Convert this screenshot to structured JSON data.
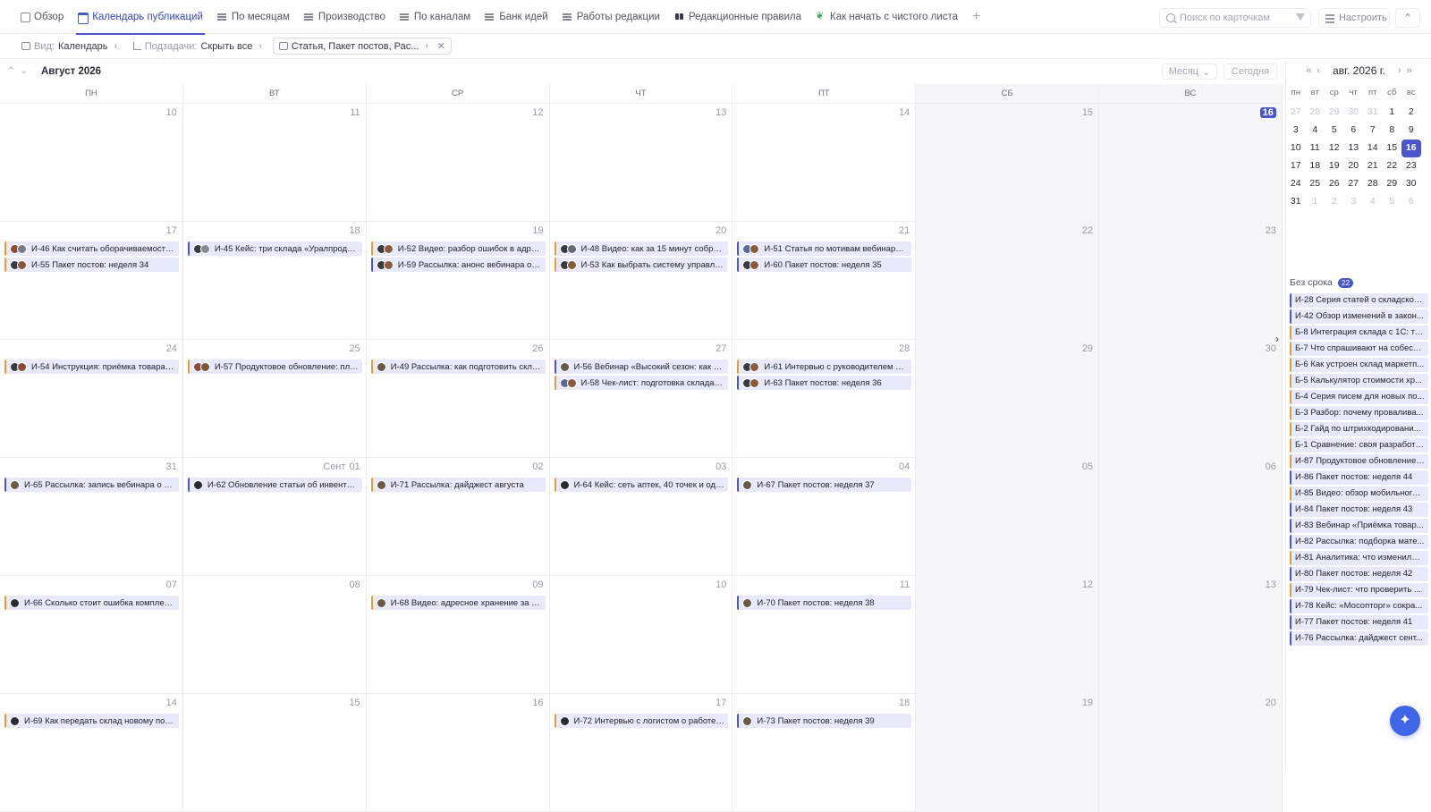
{
  "tabs": [
    {
      "label": "Обзор",
      "icon": "list-icon",
      "active": false
    },
    {
      "label": "Календарь публикаций",
      "icon": "calendar-icon",
      "active": true
    },
    {
      "label": "По месяцам",
      "icon": "grid-icon",
      "active": false
    },
    {
      "label": "Производство",
      "icon": "grid-icon",
      "active": false
    },
    {
      "label": "По каналам",
      "icon": "grid-icon",
      "active": false
    },
    {
      "label": "Банк идей",
      "icon": "grid-icon",
      "active": false
    },
    {
      "label": "Работы редакции",
      "icon": "grid-icon",
      "active": false
    },
    {
      "label": "Редакционные правила",
      "icon": "book-icon",
      "active": false
    },
    {
      "label": "Как начать с чистого листа",
      "icon": "leaf-icon",
      "active": false
    }
  ],
  "search": {
    "placeholder": "Поиск по карточкам"
  },
  "configure_label": "Настроить",
  "filters": {
    "view_label": "Вид:",
    "view_value": "Календарь",
    "subtasks_label": "Подзадачи:",
    "subtasks_value": "Скрыть все",
    "types_value": "Статья, Пакет постов, Рас..."
  },
  "calendar": {
    "month_title": "Август 2026",
    "view_mode": "Месяц",
    "today_label": "Сегодня",
    "weekdays": [
      "ПН",
      "ВТ",
      "СР",
      "ЧТ",
      "ПТ",
      "СБ",
      "ВС"
    ],
    "weeks": [
      [
        {
          "n": "10",
          "events": []
        },
        {
          "n": "11",
          "events": []
        },
        {
          "n": "12",
          "events": []
        },
        {
          "n": "13",
          "events": []
        },
        {
          "n": "14",
          "events": []
        },
        {
          "n": "15",
          "events": []
        },
        {
          "n": "16",
          "today": true,
          "events": []
        }
      ],
      [
        {
          "n": "17",
          "events": [
            {
              "text": "И-46 Как считать оборачиваемость с...",
              "av": [
                "#8b4a3a",
                "#7a7a86"
              ],
              "c": "orange"
            },
            {
              "text": "И-55 Пакет постов: неделя 34",
              "av": [
                "#3a3a44",
                "#8b5a3a"
              ],
              "c": "orange"
            }
          ]
        },
        {
          "n": "18",
          "events": [
            {
              "text": "И-45 Кейс: три склада «Уралпродукта...",
              "av": [
                "#3a3a44",
                "#8a8a96"
              ],
              "c": "blue"
            }
          ]
        },
        {
          "n": "19",
          "events": [
            {
              "text": "И-52 Видео: разбор ошибок в адресн...",
              "av": [
                "#3a3a44",
                "#8b5a3a"
              ],
              "c": "orange"
            },
            {
              "text": "И-59 Рассылка: анонс вебинара о выс...",
              "av": [
                "#3a3a44",
                "#8b5a3a"
              ],
              "c": "blue"
            }
          ]
        },
        {
          "n": "20",
          "events": [
            {
              "text": "И-48 Видео: как за 15 минут собрать ...",
              "av": [
                "#3a3a44",
                "#6a6a76"
              ],
              "c": "orange"
            },
            {
              "text": "И-53 Как выбрать систему управлени...",
              "av": [
                "#3a3a44",
                "#8b5a3a"
              ],
              "c": "orange"
            }
          ]
        },
        {
          "n": "21",
          "events": [
            {
              "text": "И-51 Статья по мотивам вебинара о п...",
              "av": [
                "#5a6a9a",
                "#8b5a3a"
              ],
              "c": "blue"
            },
            {
              "text": "И-60 Пакет постов: неделя 35",
              "av": [
                "#3a3a44",
                "#8b5a3a"
              ],
              "c": "blue"
            }
          ]
        },
        {
          "n": "22",
          "events": []
        },
        {
          "n": "23",
          "events": []
        }
      ],
      [
        {
          "n": "24",
          "events": [
            {
              "text": "И-54 Инструкция: приёмка товара по ...",
              "av": [
                "#3a3a44",
                "#8b4a3a"
              ],
              "c": "orange"
            }
          ]
        },
        {
          "n": "25",
          "events": [
            {
              "text": "И-57 Продуктовое обновление: плани...",
              "av": [
                "#8b4a3a",
                "#7a5a3a"
              ],
              "c": "orange"
            }
          ]
        },
        {
          "n": "26",
          "events": [
            {
              "text": "И-49 Рассылка: как подготовить склад...",
              "av": [
                "#6a5a4a"
              ],
              "c": "orange"
            }
          ]
        },
        {
          "n": "27",
          "events": [
            {
              "text": "И-56 Вебинар «Высокий сезон: как скл...",
              "av": [
                "#6a5a4a"
              ],
              "c": "blue"
            },
            {
              "text": "И-58 Чек-лист: подготовка склада к с...",
              "av": [
                "#5a6a9a",
                "#8b5a3a"
              ],
              "c": "orange"
            }
          ]
        },
        {
          "n": "28",
          "events": [
            {
              "text": "И-61 Интервью с руководителем скла...",
              "av": [
                "#3a3a44",
                "#8b5a3a"
              ],
              "c": "orange"
            },
            {
              "text": "И-63 Пакет постов: неделя 36",
              "av": [
                "#3a3a44",
                "#8b5a3a"
              ],
              "c": "blue"
            }
          ]
        },
        {
          "n": "29",
          "events": []
        },
        {
          "n": "30",
          "events": []
        }
      ],
      [
        {
          "n": "31",
          "events": [
            {
              "text": "И-65 Рассылка: запись вебинара о выс...",
              "av": [
                "#6a5a4a"
              ],
              "c": "blue"
            }
          ]
        },
        {
          "n": "01",
          "mlabel": "Сент",
          "events": [
            {
              "text": "И-62 Обновление статьи об инвентари...",
              "av": [
                "#2b2b33"
              ],
              "c": "blue"
            }
          ]
        },
        {
          "n": "02",
          "events": [
            {
              "text": "И-71 Рассылка: дайджест августа",
              "av": [
                "#6a5a4a"
              ],
              "c": "orange"
            }
          ]
        },
        {
          "n": "03",
          "events": [
            {
              "text": "И-64 Кейс: сеть аптек, 40 точек и один...",
              "av": [
                "#2b2b33"
              ],
              "c": "orange"
            }
          ]
        },
        {
          "n": "04",
          "events": [
            {
              "text": "И-67 Пакет постов: неделя 37",
              "av": [
                "#6a5a4a"
              ],
              "c": "blue"
            }
          ]
        },
        {
          "n": "05",
          "events": []
        },
        {
          "n": "06",
          "events": []
        }
      ],
      [
        {
          "n": "07",
          "events": [
            {
              "text": "И-66 Сколько стоит ошибка комплекта...",
              "av": [
                "#2b2b33"
              ],
              "c": "orange"
            }
          ]
        },
        {
          "n": "08",
          "events": []
        },
        {
          "n": "09",
          "events": [
            {
              "text": "И-68 Видео: адресное хранение за 10 ...",
              "av": [
                "#6a5a4a"
              ],
              "c": "orange"
            }
          ]
        },
        {
          "n": "10",
          "events": []
        },
        {
          "n": "11",
          "events": [
            {
              "text": "И-70 Пакет постов: неделя 38",
              "av": [
                "#6a5a4a"
              ],
              "c": "blue"
            }
          ]
        },
        {
          "n": "12",
          "events": []
        },
        {
          "n": "13",
          "events": []
        }
      ],
      [
        {
          "n": "14",
          "events": [
            {
              "text": "И-69 Как передать склад новому подр...",
              "av": [
                "#2b2b33"
              ],
              "c": "orange"
            }
          ]
        },
        {
          "n": "15",
          "events": []
        },
        {
          "n": "16",
          "events": []
        },
        {
          "n": "17",
          "events": [
            {
              "text": "И-72 Интервью с логистом о работе в ...",
              "av": [
                "#2b2b33"
              ],
              "c": "orange"
            }
          ]
        },
        {
          "n": "18",
          "events": [
            {
              "text": "И-73 Пакет постов: неделя 39",
              "av": [
                "#6a5a4a"
              ],
              "c": "blue"
            }
          ]
        },
        {
          "n": "19",
          "events": []
        },
        {
          "n": "20",
          "events": []
        }
      ]
    ]
  },
  "mini_calendar": {
    "title": "авг. 2026 г.",
    "weekdays": [
      "пн",
      "вт",
      "ср",
      "чт",
      "пт",
      "сб",
      "вс"
    ],
    "rows": [
      [
        {
          "d": "27",
          "off": true
        },
        {
          "d": "28",
          "off": true
        },
        {
          "d": "29",
          "off": true
        },
        {
          "d": "30",
          "off": true
        },
        {
          "d": "31",
          "off": true
        },
        {
          "d": "1"
        },
        {
          "d": "2"
        }
      ],
      [
        {
          "d": "3"
        },
        {
          "d": "4"
        },
        {
          "d": "5"
        },
        {
          "d": "6"
        },
        {
          "d": "7"
        },
        {
          "d": "8"
        },
        {
          "d": "9"
        }
      ],
      [
        {
          "d": "10"
        },
        {
          "d": "11"
        },
        {
          "d": "12"
        },
        {
          "d": "13"
        },
        {
          "d": "14"
        },
        {
          "d": "15"
        },
        {
          "d": "16",
          "sel": true
        }
      ],
      [
        {
          "d": "17"
        },
        {
          "d": "18"
        },
        {
          "d": "19"
        },
        {
          "d": "20"
        },
        {
          "d": "21"
        },
        {
          "d": "22"
        },
        {
          "d": "23"
        }
      ],
      [
        {
          "d": "24"
        },
        {
          "d": "25"
        },
        {
          "d": "26"
        },
        {
          "d": "27"
        },
        {
          "d": "28"
        },
        {
          "d": "29"
        },
        {
          "d": "30"
        }
      ],
      [
        {
          "d": "31"
        },
        {
          "d": "1",
          "off": true
        },
        {
          "d": "2",
          "off": true
        },
        {
          "d": "3",
          "off": true
        },
        {
          "d": "4",
          "off": true
        },
        {
          "d": "5",
          "off": true
        },
        {
          "d": "6",
          "off": true
        }
      ]
    ]
  },
  "no_date": {
    "label": "Без срока",
    "count": "22",
    "items": [
      {
        "text": "И-28 Серия статей о складской...",
        "c": "blue"
      },
      {
        "text": "И-42 Обзор изменений в закон...",
        "c": "blue"
      },
      {
        "text": "Б-8 Интеграция склада с 1С: ти...",
        "c": "orange"
      },
      {
        "text": "Б-7 Что спрашивают на собесе...",
        "c": "orange"
      },
      {
        "text": "Б-6 Как устроен склад маркетп...",
        "c": "orange"
      },
      {
        "text": "Б-5 Калькулятор стоимости хр...",
        "c": "orange"
      },
      {
        "text": "Б-4 Серия писем для новых по...",
        "c": "orange"
      },
      {
        "text": "Б-3 Разбор: почему проваливa...",
        "c": "orange"
      },
      {
        "text": "Б-2 Гайд по штрихкодировани...",
        "c": "orange"
      },
      {
        "text": "Б-1 Сравнение: своя разработк...",
        "c": "orange"
      },
      {
        "text": "И-87 Продуктовое обновление:...",
        "c": "orange"
      },
      {
        "text": "И-86 Пакет постов: неделя 44",
        "c": "blue"
      },
      {
        "text": "И-85 Видео: обзор мобильного ...",
        "c": "orange"
      },
      {
        "text": "И-84 Пакет постов: неделя 43",
        "c": "blue"
      },
      {
        "text": "И-83 Вебинар «Приёмка товар...",
        "c": "blue"
      },
      {
        "text": "И-82 Рассылка: подборка мате...",
        "c": "blue"
      },
      {
        "text": "И-81 Аналитика: что изменилос...",
        "c": "orange"
      },
      {
        "text": "И-80 Пакет постов: неделя 42",
        "c": "blue"
      },
      {
        "text": "И-79 Чек-лист: что проверить ...",
        "c": "orange"
      },
      {
        "text": "И-78 Кейс: «Мосопторг» сокра...",
        "c": "blue"
      },
      {
        "text": "И-77 Пакет постов: неделя 41",
        "c": "blue"
      },
      {
        "text": "И-76 Рассылка: дайджест сент...",
        "c": "blue"
      }
    ]
  },
  "colors": {
    "accent": "#4a56c9",
    "event_bg": "#e8e9fb",
    "orange_bar": "#e0a234",
    "fab": "#3f66e6"
  }
}
